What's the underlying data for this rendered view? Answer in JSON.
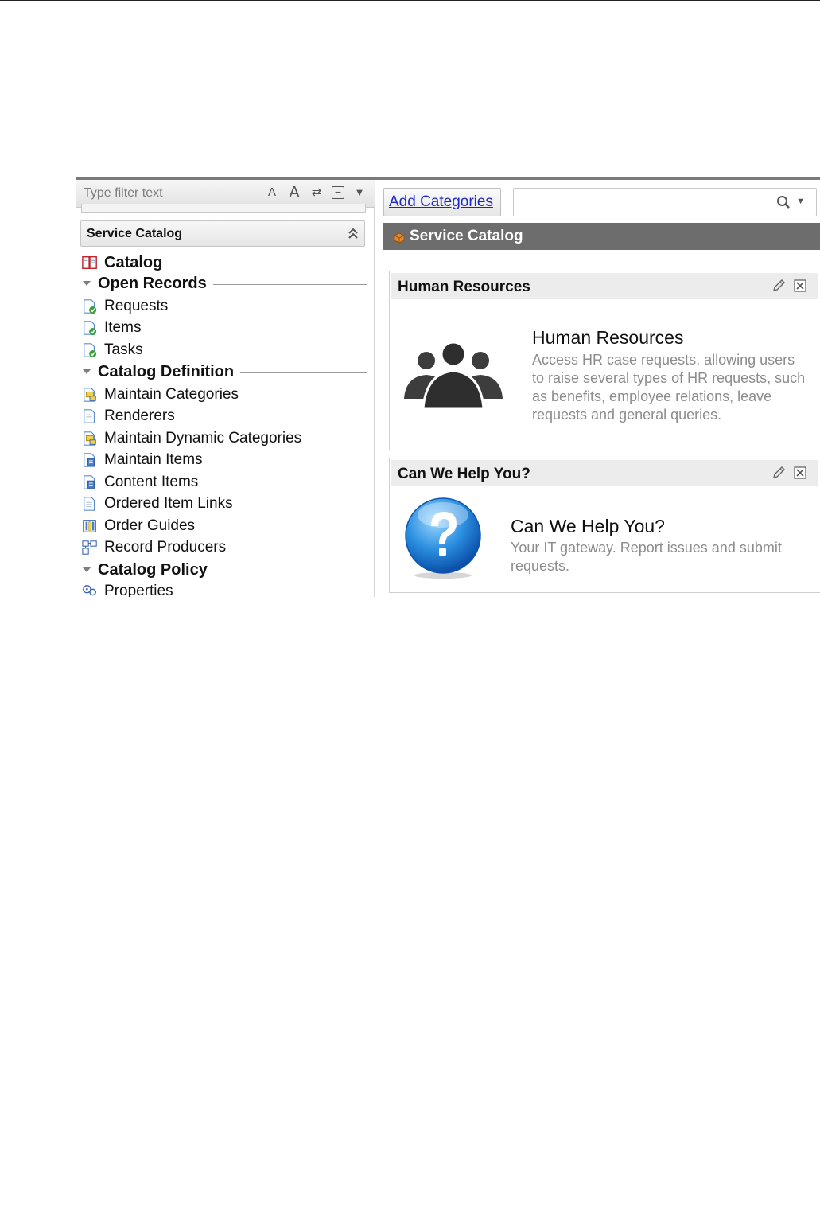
{
  "navigator": {
    "filter_placeholder": "Type filter text",
    "tools": {
      "font_small": "A",
      "font_large": "A",
      "refresh": "⇄",
      "collapse_all": "−",
      "menu": "▼"
    },
    "application_title": "Service Catalog",
    "modules": {
      "catalog": "Catalog",
      "open_records": "Open Records",
      "requests": "Requests",
      "items": "Items",
      "tasks": "Tasks",
      "catalog_definition": "Catalog Definition",
      "maintain_categories": "Maintain Categories",
      "renderers": "Renderers",
      "maintain_dynamic_categories": "Maintain Dynamic Categories",
      "maintain_items": "Maintain Items",
      "content_items": "Content Items",
      "ordered_item_links": "Ordered Item Links",
      "order_guides": "Order Guides",
      "record_producers": "Record Producers",
      "catalog_policy": "Catalog Policy",
      "properties": "Properties"
    }
  },
  "content": {
    "add_categories_label": "Add Categories",
    "search_value": "",
    "page_title": "Service Catalog",
    "panels": [
      {
        "header": "Human Resources",
        "title": "Human Resources",
        "description": "Access HR case requests, allowing users to raise several types of HR requests, such as benefits, employee relations, leave requests and general queries."
      },
      {
        "header": "Can We Help You?",
        "title": "Can We Help You?",
        "description": "Your IT gateway. Report issues and submit requests."
      }
    ]
  },
  "colors": {
    "page_bar": "#6d6d6d",
    "link": "#1b27c9",
    "panel_header": "#ececec",
    "description_text": "#8c8c8c"
  },
  "icons": [
    "catalog-icon",
    "record-check-icon",
    "category-icon",
    "document-icon",
    "items-icon",
    "order-guide-icon",
    "record-producer-icon",
    "properties-icon",
    "people-icon",
    "help-icon",
    "pencil-icon",
    "close-icon",
    "search-icon"
  ]
}
